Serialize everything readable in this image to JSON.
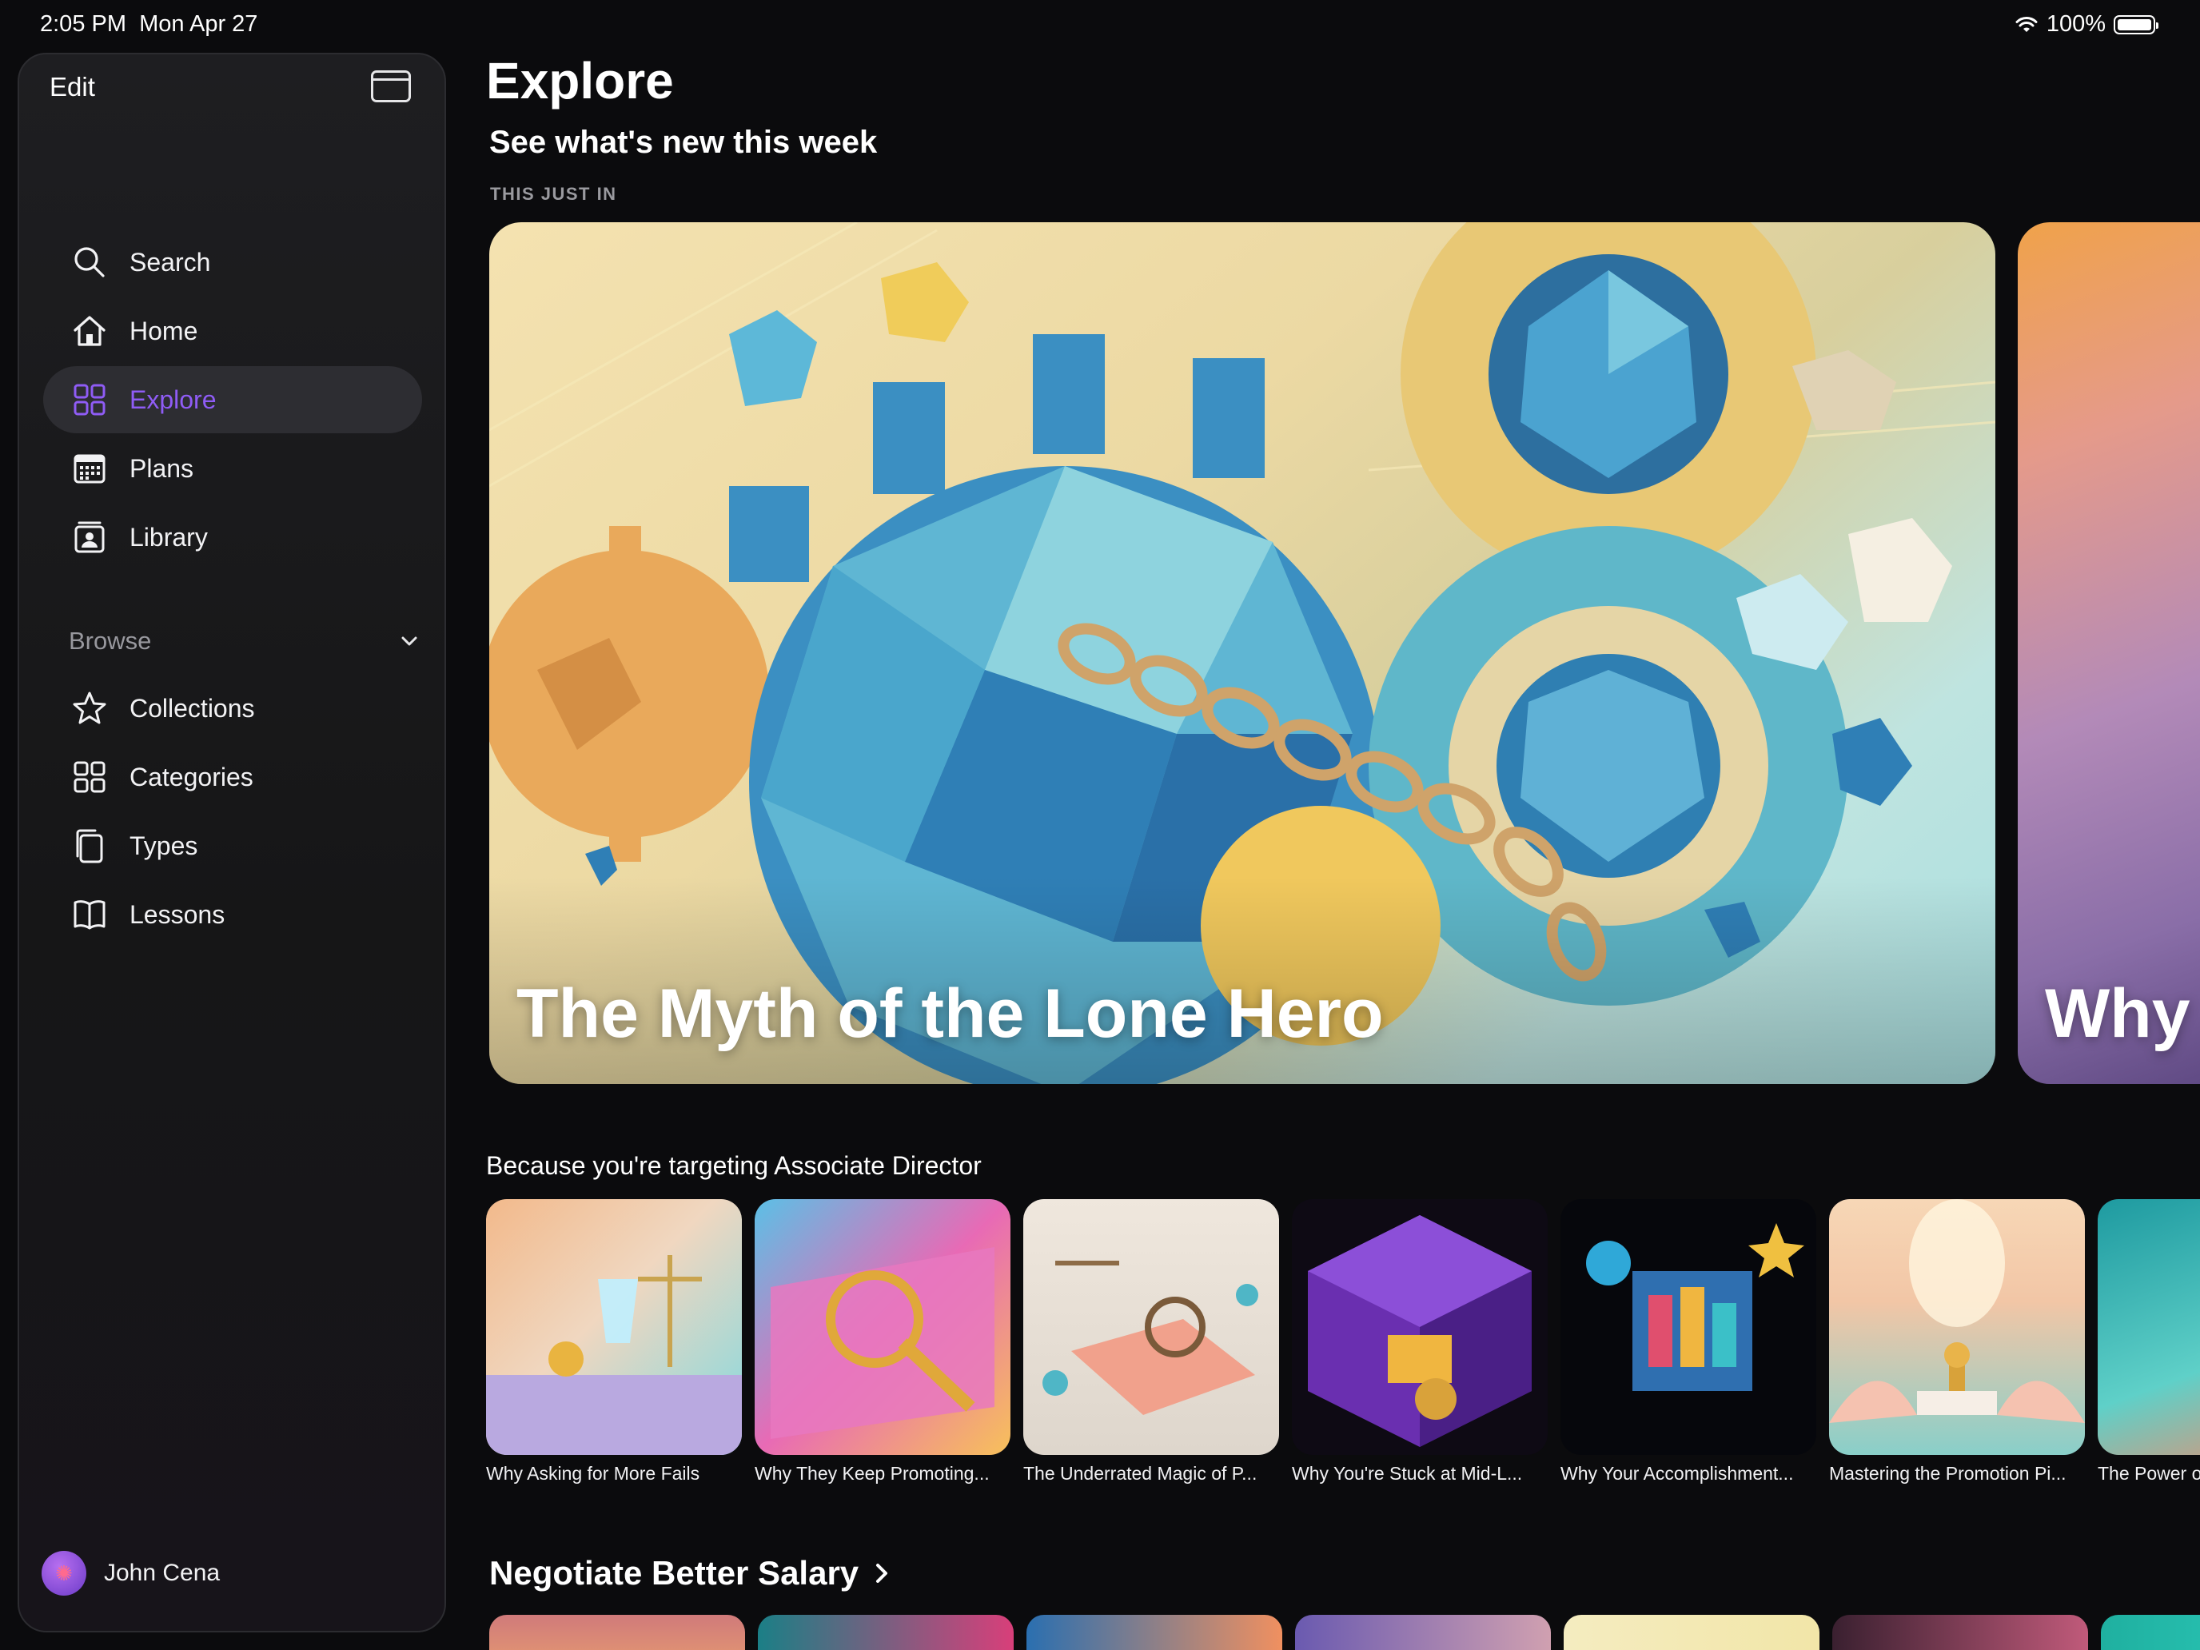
{
  "status": {
    "time": "2:05 PM",
    "date": "Mon Apr 27",
    "battery": "100%"
  },
  "sidebar": {
    "edit_label": "Edit",
    "items": [
      {
        "label": "Search",
        "icon": "search-icon"
      },
      {
        "label": "Home",
        "icon": "home-icon"
      },
      {
        "label": "Explore",
        "icon": "grid-icon",
        "active": true
      },
      {
        "label": "Plans",
        "icon": "calendar-icon"
      },
      {
        "label": "Library",
        "icon": "library-icon"
      }
    ],
    "browse_label": "Browse",
    "browse_items": [
      {
        "label": "Collections",
        "icon": "star-icon"
      },
      {
        "label": "Categories",
        "icon": "grid-icon"
      },
      {
        "label": "Types",
        "icon": "cards-icon"
      },
      {
        "label": "Lessons",
        "icon": "book-icon"
      }
    ],
    "user": {
      "name": "John Cena"
    }
  },
  "main": {
    "title": "Explore",
    "section_heading": "See what's new this week",
    "eyebrow": "THIS JUST IN",
    "hero": {
      "title": "The Myth of the Lone Hero"
    },
    "hero_next": {
      "title": "Why"
    },
    "row_heading": "Because you're targeting Associate Director",
    "cards": [
      {
        "title": "Why Asking for More Fails"
      },
      {
        "title": "Why They Keep Promoting..."
      },
      {
        "title": "The Underrated Magic of P..."
      },
      {
        "title": "Why You're Stuck at Mid-L..."
      },
      {
        "title": "Why Your Accomplishment..."
      },
      {
        "title": "Mastering the Promotion Pi..."
      },
      {
        "title": "The Power o"
      }
    ],
    "negotiate_heading": "Negotiate Better Salary"
  },
  "colors": {
    "accent": "#8f5cf5",
    "background": "#0b0b0d",
    "sidebar": "#1b1b1e"
  }
}
